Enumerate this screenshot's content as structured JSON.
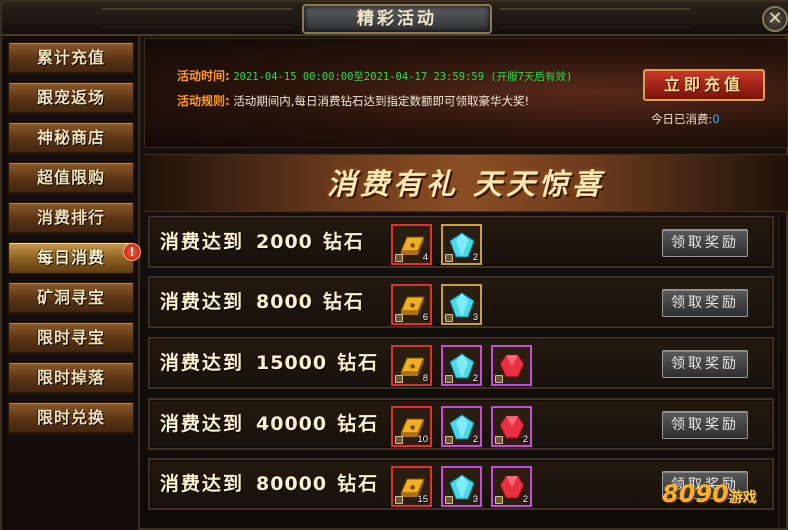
{
  "window": {
    "title": "精彩活动",
    "close_glyph": "✕"
  },
  "sidebar": {
    "items": [
      {
        "label": "累计充值"
      },
      {
        "label": "跟宠返场"
      },
      {
        "label": "神秘商店"
      },
      {
        "label": "超值限购"
      },
      {
        "label": "消费排行"
      },
      {
        "label": "每日消费",
        "active": true
      },
      {
        "label": "矿洞寻宝",
        "badge": "!"
      },
      {
        "label": "限时寻宝"
      },
      {
        "label": "限时掉落"
      },
      {
        "label": "限时兑换"
      }
    ]
  },
  "info": {
    "time_label": "活动时间:",
    "time_value": "2021-04-15 00:00:00至2021-04-17 23:59:59 (开服7天后有效)",
    "rule_label": "活动规则:",
    "rule_value": "活动期间内,每日消费钻石达到指定数额即可领取豪华大奖!",
    "recharge_label": "立即充值",
    "spent_label": "今日已消费:",
    "spent_value": "0"
  },
  "banner": {
    "text": "消费有礼  天天惊喜"
  },
  "tiers": [
    {
      "prefix": "消费达到",
      "amount": "2000",
      "unit": "钻石",
      "rewards": [
        {
          "type": "gold-bar",
          "count": "4"
        },
        {
          "type": "cyan-gem",
          "count": "2"
        }
      ]
    },
    {
      "prefix": "消费达到",
      "amount": "8000",
      "unit": "钻石",
      "rewards": [
        {
          "type": "gold-bar",
          "count": "6"
        },
        {
          "type": "cyan-gem",
          "count": "3"
        }
      ]
    },
    {
      "prefix": "消费达到",
      "amount": "15000",
      "unit": "钻石",
      "rewards": [
        {
          "type": "gold-bar",
          "count": "8"
        },
        {
          "type": "cyan-gem",
          "count": "2"
        },
        {
          "type": "red-gem",
          "count": ""
        }
      ]
    },
    {
      "prefix": "消费达到",
      "amount": "40000",
      "unit": "钻石",
      "rewards": [
        {
          "type": "gold-bar",
          "count": "10"
        },
        {
          "type": "cyan-gem",
          "count": "2"
        },
        {
          "type": "red-gem",
          "count": "2"
        }
      ]
    },
    {
      "prefix": "消费达到",
      "amount": "80000",
      "unit": "钻石",
      "rewards": [
        {
          "type": "gold-bar",
          "count": "15"
        },
        {
          "type": "cyan-gem",
          "count": "3"
        },
        {
          "type": "red-gem",
          "count": "2"
        }
      ]
    }
  ],
  "claim_label": "领取奖励",
  "watermark": {
    "num": "8090",
    "zh": "游戏"
  },
  "colors": {
    "accent_orange": "#ff9a1a",
    "time_green": "#2edc4a",
    "spent_blue": "#3ab8ff"
  }
}
